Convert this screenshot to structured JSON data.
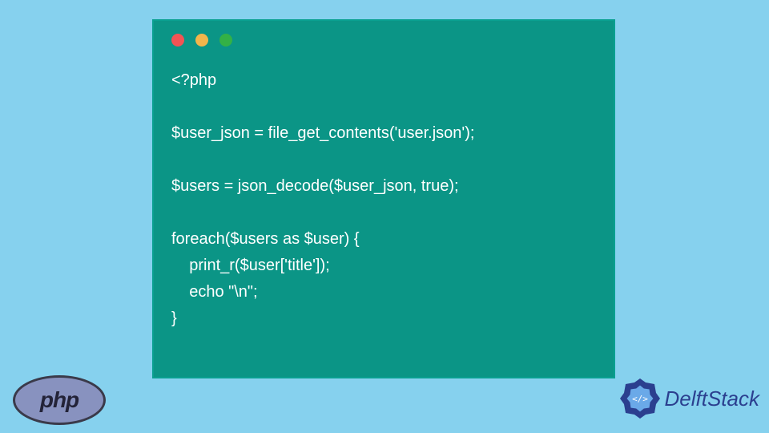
{
  "code": {
    "lines": [
      "<?php",
      "",
      "$user_json = file_get_contents('user.json');",
      "",
      "$users = json_decode($user_json, true);",
      "",
      "foreach($users as $user) {",
      "    print_r($user['title']);",
      "    echo \"\\n\";",
      "}"
    ]
  },
  "logos": {
    "php": "php",
    "delftstack": "DelftStack"
  },
  "colors": {
    "background": "#86d1ee",
    "codeWindow": "#0b9586",
    "dotRed": "#f25454",
    "dotYellow": "#f2b54b",
    "dotGreen": "#33b146",
    "phpEllipse": "#8892bf",
    "delftBlue": "#2b3f8f"
  }
}
